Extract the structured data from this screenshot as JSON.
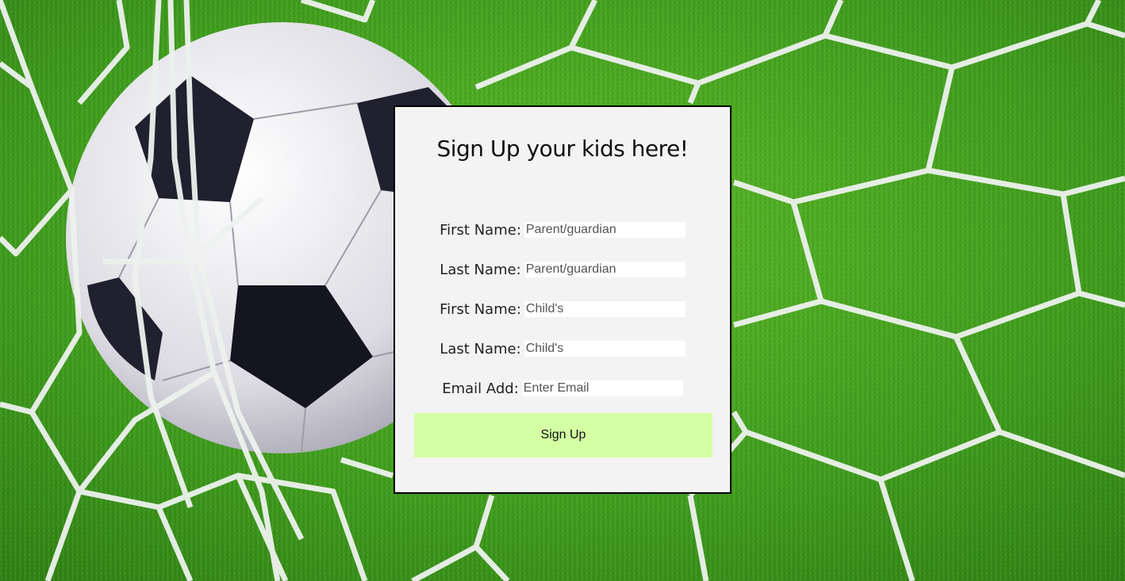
{
  "form": {
    "title": "Sign Up your kids here!",
    "fields": [
      {
        "label": "First Name:",
        "placeholder": "Parent/guardian"
      },
      {
        "label": "Last Name:",
        "placeholder": "Parent/guardian"
      },
      {
        "label": "First Name:",
        "placeholder": "Child's"
      },
      {
        "label": "Last Name:",
        "placeholder": "Child's"
      },
      {
        "label": "Email Add:",
        "placeholder": "Enter Email"
      }
    ],
    "submit_label": "Sign Up"
  },
  "colors": {
    "panel_bg": "#f3f3f3",
    "panel_border": "#000000",
    "button_bg": "#d4ffa4",
    "grass": "#3f9a1f"
  },
  "background": {
    "icon": "soccer-ball-in-net"
  }
}
